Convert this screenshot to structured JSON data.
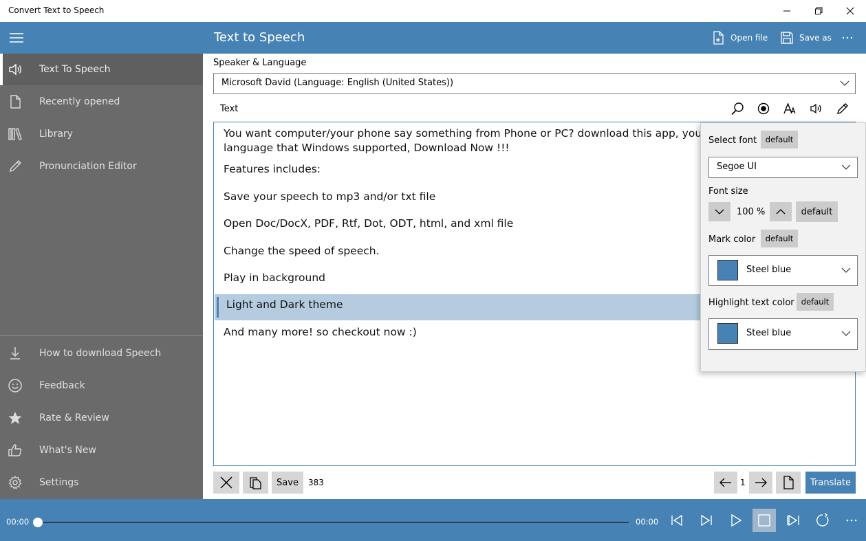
{
  "window": {
    "title": "Convert Text to Speech"
  },
  "header": {
    "title": "Text to Speech",
    "open_file": "Open file",
    "save_as": "Save as"
  },
  "sidebar": {
    "items": [
      {
        "label": "Text To Speech",
        "icon": "speaker-icon",
        "active": true
      },
      {
        "label": "Recently opened",
        "icon": "document-icon"
      },
      {
        "label": "Library",
        "icon": "library-icon"
      },
      {
        "label": "Pronunciation Editor",
        "icon": "pencil-icon"
      }
    ],
    "bottom_items": [
      {
        "label": "How to download Speech",
        "icon": "download-icon"
      },
      {
        "label": "Feedback",
        "icon": "smiley-icon"
      },
      {
        "label": "Rate & Review",
        "icon": "star-icon"
      },
      {
        "label": "What's New",
        "icon": "thumbs-up-icon"
      },
      {
        "label": "Settings",
        "icon": "gear-icon"
      }
    ]
  },
  "speaker": {
    "label": "Speaker & Language",
    "value": "Microsoft David (Language: English (United States))"
  },
  "text_section": {
    "label": "Text"
  },
  "editor": {
    "lines": [
      "You want computer/your phone say something from Phone or PC? download this app, you can conv",
      "language that Windows supported, Download Now !!!",
      "Features includes:",
      "Save your speech to mp3 and/or txt file",
      "Open Doc/DocX, PDF, Rtf, Dot, ODT, html, and xml file",
      "Change the speed of speech.",
      "Play in background",
      "Light and Dark theme",
      "And many more! so checkout now :)"
    ],
    "highlighted_line_index": 7,
    "highlight_color": "#b5cbe0"
  },
  "bottom_toolbar": {
    "save_label": "Save",
    "char_count": "383",
    "page_number": "1",
    "translate_label": "Translate"
  },
  "font_flyout": {
    "select_font_label": "Select font",
    "font_value": "Segoe UI",
    "font_size_label": "Font size",
    "font_size_value": "100 %",
    "mark_color_label": "Mark color",
    "mark_color_value": "Steel blue",
    "highlight_label": "Highlight text color",
    "highlight_value": "Steel blue",
    "default_label": "default",
    "swatch_color": "#4682b4"
  },
  "player": {
    "current_time": "00:00",
    "total_time": "00:00"
  },
  "colors": {
    "accent": "#4682b4",
    "sidebar": "#6a6a6a"
  }
}
